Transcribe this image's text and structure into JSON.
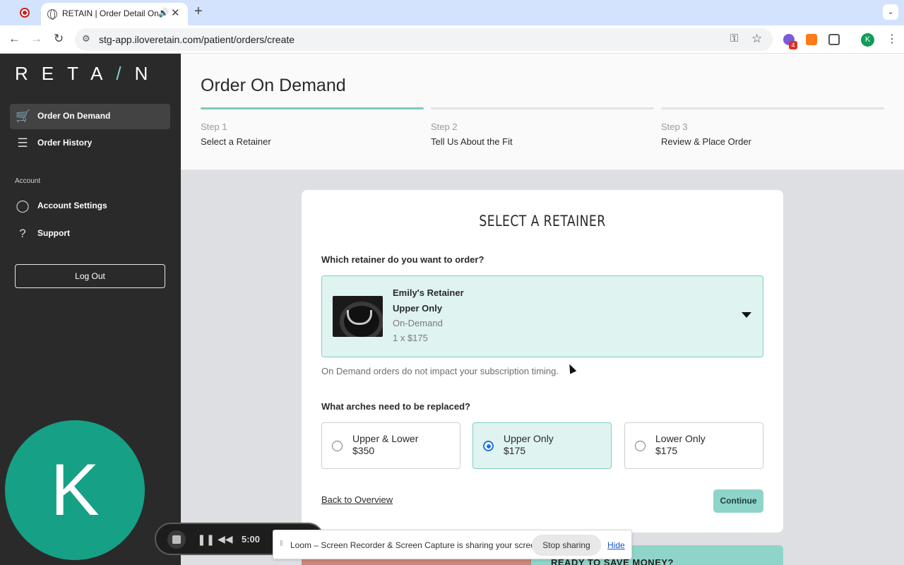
{
  "browser": {
    "tab_title": "RETAIN | Order Detail On Demand",
    "url": "stg-app.iloveretain.com/patient/orders/create",
    "extension_badge": "4",
    "profile_initial": "K"
  },
  "sidebar": {
    "logo_left": "RETA",
    "logo_slash": "/",
    "logo_right": "N",
    "items": [
      {
        "label": "Order On Demand",
        "icon": "cart-icon"
      },
      {
        "label": "Order History",
        "icon": "list-icon"
      }
    ],
    "account_section": "Account",
    "account_items": [
      {
        "label": "Account Settings",
        "icon": "user-icon"
      },
      {
        "label": "Support",
        "icon": "help-icon"
      }
    ],
    "logout_label": "Log Out"
  },
  "header": {
    "title": "Order On Demand",
    "steps": [
      {
        "number": "Step 1",
        "name": "Select a Retainer",
        "complete": true
      },
      {
        "number": "Step 2",
        "name": "Tell Us About the Fit",
        "complete": false
      },
      {
        "number": "Step 3",
        "name": "Review & Place Order",
        "complete": false
      }
    ]
  },
  "card": {
    "title": "SELECT A RETAINER",
    "question_retainer": "Which retainer do you want to order?",
    "selected_retainer": {
      "name": "Emily's Retainer",
      "arch": "Upper Only",
      "type": "On-Demand",
      "quantity_price": "1 x $175"
    },
    "helper_text": "On Demand orders do not impact your subscription timing.",
    "question_arches": "What arches need to be replaced?",
    "arch_options": [
      {
        "name": "Upper & Lower",
        "price": "$350",
        "selected": false
      },
      {
        "name": "Upper Only",
        "price": "$175",
        "selected": true
      },
      {
        "name": "Lower Only",
        "price": "$175",
        "selected": false
      }
    ],
    "back_link": "Back to Overview",
    "continue_label": "Continue"
  },
  "promo": {
    "text": "READY TO SAVE MONEY?"
  },
  "loom": {
    "avatar_initial": "K",
    "timer": "5:00",
    "share_message": "Loom – Screen Recorder & Screen Capture is sharing your screen.",
    "stop_sharing_label": "Stop sharing",
    "hide_label": "Hide"
  },
  "colors": {
    "accent_teal": "#7bc9bd",
    "selected_bg": "#dff3f1",
    "sidebar_bg": "#2a2a2a",
    "avatar_green": "#16a085"
  }
}
